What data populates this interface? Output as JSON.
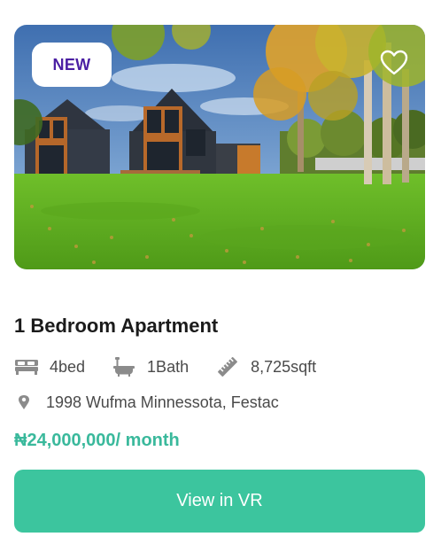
{
  "listing": {
    "badge": "NEW",
    "title": "1 Bedroom Apartment",
    "features": [
      {
        "icon": "bed-icon",
        "label": "4bed"
      },
      {
        "icon": "bathtub-icon",
        "label": "1Bath"
      },
      {
        "icon": "ruler-icon",
        "label": "8,725sqft"
      }
    ],
    "address_icon": "location-pin-icon",
    "address": "1998 Wufma Minnessota, Festac",
    "price": "₦24,000,000/ month",
    "cta": "View in VR",
    "favorite_icon": "heart-outline-icon",
    "photo": "two modern dark wood-clad houses on a green lawn with autumn trees"
  },
  "colors": {
    "accent": "#3CC59E",
    "price": "#3AB99C",
    "badge_text": "#4B1FA3",
    "text": "#1B1B1B",
    "muted": "#4A4A4A"
  }
}
